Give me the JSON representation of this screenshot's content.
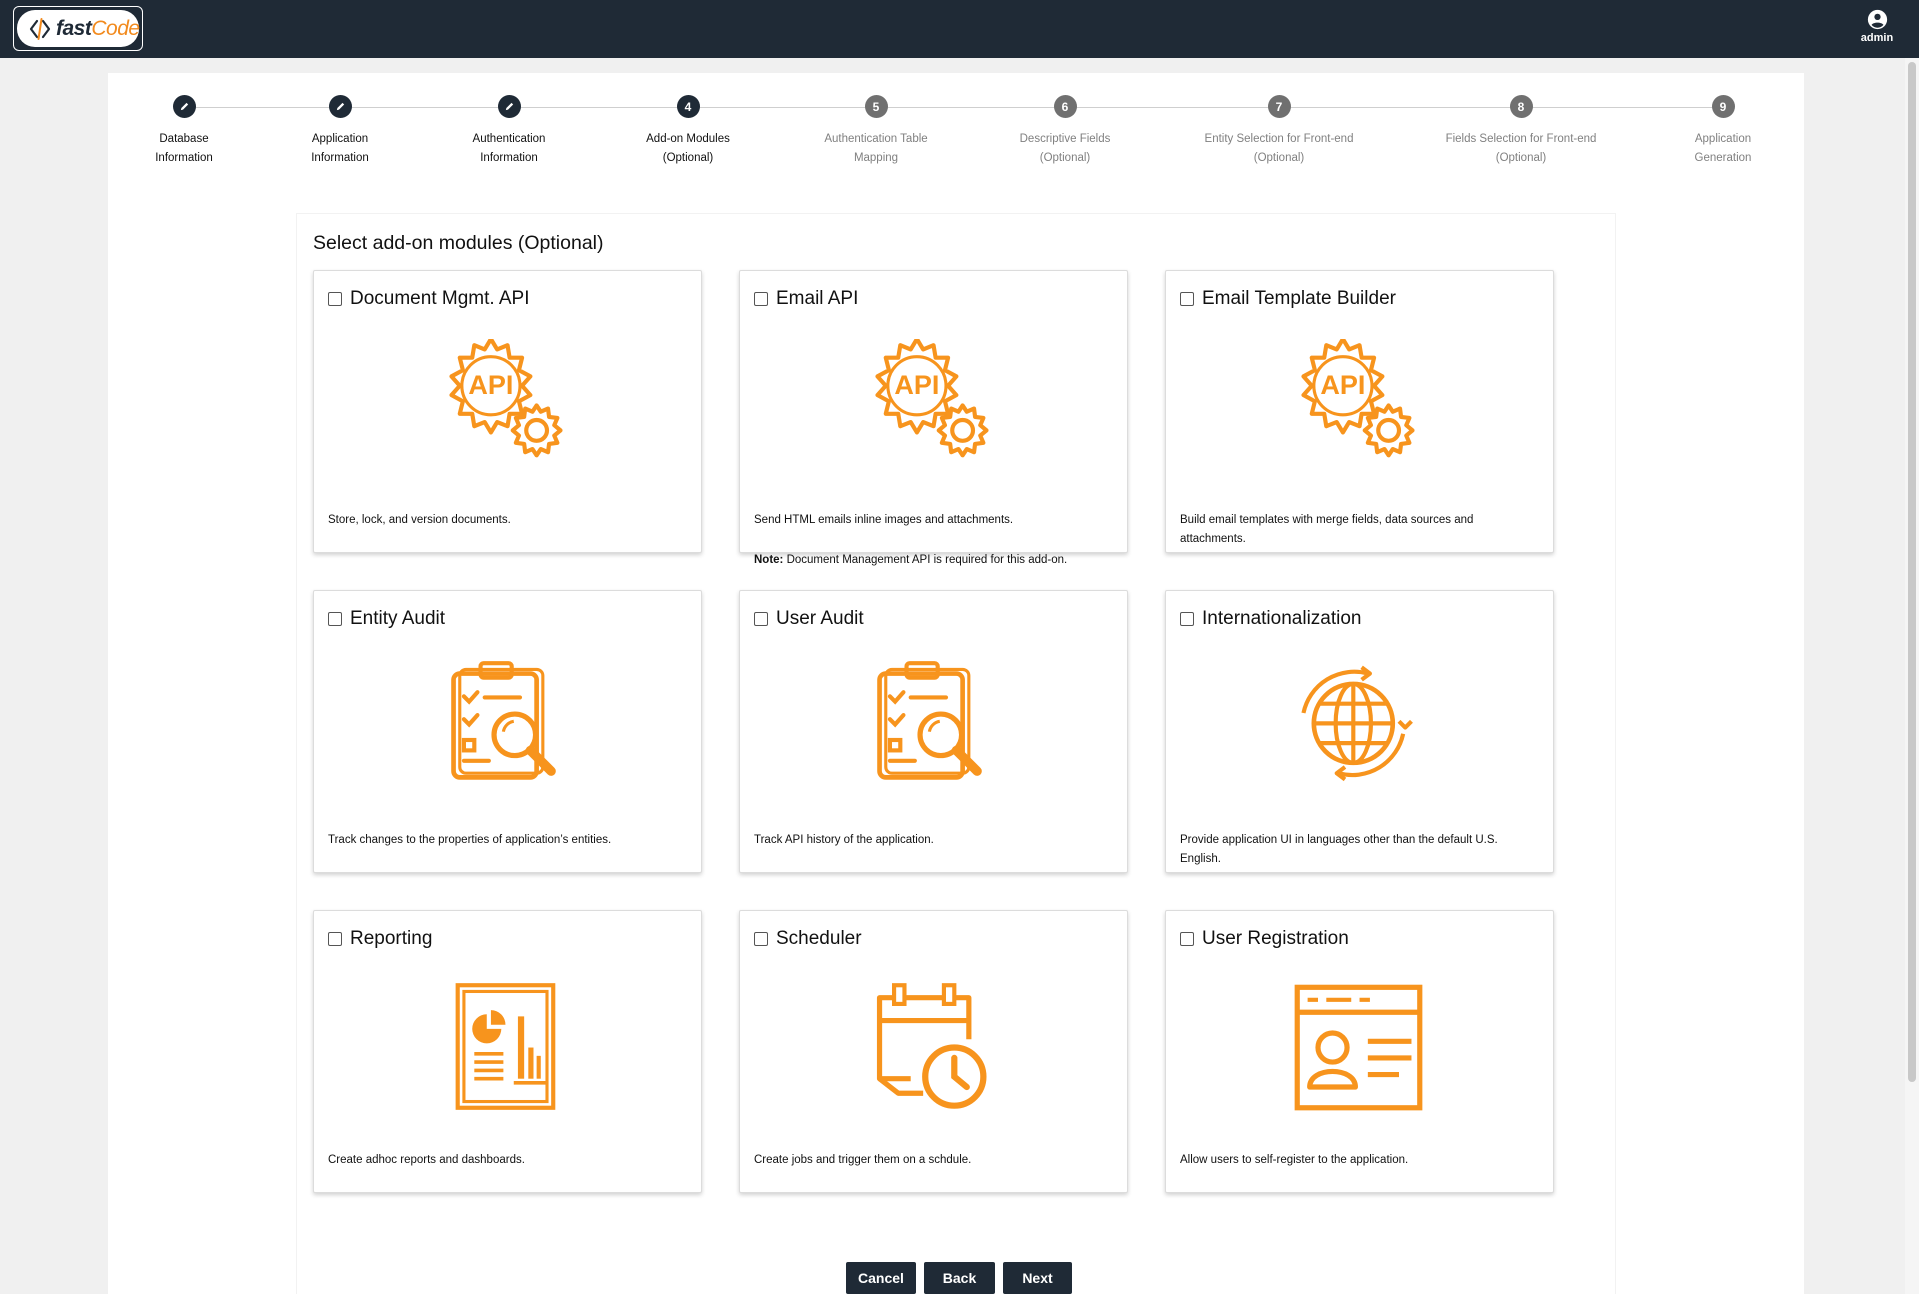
{
  "brand": {
    "fast": "fast",
    "code": "Code",
    "accent": "#f28a1d",
    "dark": "#1f2a36"
  },
  "user": {
    "label": "admin",
    "icon": "account-circle-icon"
  },
  "steps": [
    {
      "number": "",
      "state": "done",
      "icon": "pencil-icon",
      "line1": "Database",
      "line2": "Information"
    },
    {
      "number": "",
      "state": "done",
      "icon": "pencil-icon",
      "line1": "Application",
      "line2": "Information"
    },
    {
      "number": "",
      "state": "done",
      "icon": "pencil-icon",
      "line1": "Authentication",
      "line2": "Information"
    },
    {
      "number": "4",
      "state": "current",
      "line1": "Add-on Modules",
      "line2": "(Optional)"
    },
    {
      "number": "5",
      "state": "pending",
      "line1": "Authentication Table",
      "line2": "Mapping"
    },
    {
      "number": "6",
      "state": "pending",
      "line1": "Descriptive Fields",
      "line2": "(Optional)"
    },
    {
      "number": "7",
      "state": "pending",
      "line1": "Entity Selection for Front-end",
      "line2": "(Optional)"
    },
    {
      "number": "8",
      "state": "pending",
      "line1": "Fields Selection for Front-end",
      "line2": "(Optional)"
    },
    {
      "number": "9",
      "state": "pending",
      "line1": "Application",
      "line2": "Generation"
    }
  ],
  "section_title": "Select add-on modules (Optional)",
  "modules": [
    {
      "title": "Document Mgmt. API",
      "icon": "api-gear-icon",
      "description": "Store, lock, and version documents.",
      "checked": false
    },
    {
      "title": "Email API",
      "icon": "api-gear-icon",
      "description": "Send HTML emails inline images and attachments.",
      "note_label": "Note:",
      "note_text": " Document Management API is required for this add-on.",
      "checked": false
    },
    {
      "title": "Email Template Builder",
      "icon": "api-gear-icon",
      "description": "Build email templates with merge fields, data sources and attachments.",
      "checked": false
    },
    {
      "title": "Entity Audit",
      "icon": "clipboard-search-icon",
      "description": "Track changes to the properties of application’s entities.",
      "checked": false
    },
    {
      "title": "User Audit",
      "icon": "clipboard-search-icon",
      "description": "Track API history of the application.",
      "checked": false
    },
    {
      "title": "Internationalization",
      "icon": "globe-icon",
      "description": "Provide application UI in languages other than the default U.S. English.",
      "checked": false
    },
    {
      "title": "Reporting",
      "icon": "report-icon",
      "description": "Create adhoc reports and dashboards.",
      "checked": false
    },
    {
      "title": "Scheduler",
      "icon": "calendar-clock-icon",
      "description": "Create jobs and trigger them on a schdule.",
      "checked": false
    },
    {
      "title": "User Registration",
      "icon": "registration-form-icon",
      "description": "Allow users to self-register to the application.",
      "checked": false
    }
  ],
  "buttons": {
    "cancel": "Cancel",
    "back": "Back",
    "next": "Next"
  }
}
